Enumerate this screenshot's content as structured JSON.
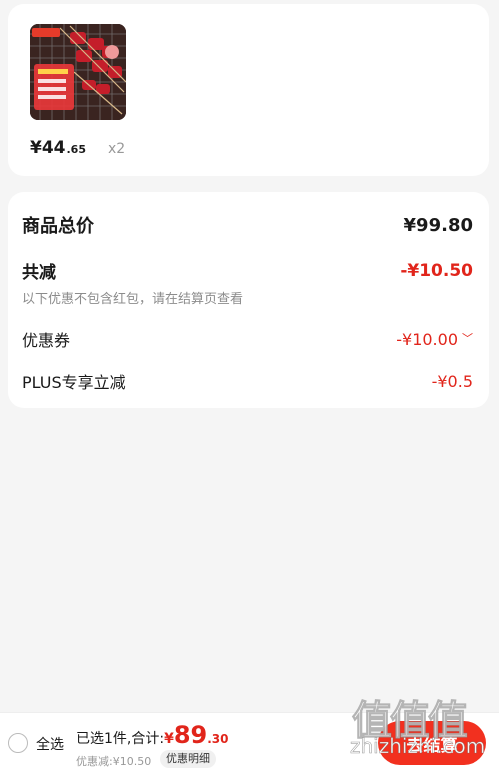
{
  "product": {
    "image_icon": "grilled-meat-skewers-image",
    "price_integer": "¥44",
    "price_decimal": ".65",
    "quantity": "x2"
  },
  "summary": {
    "total_label": "商品总价",
    "total_value": "¥99.80",
    "reduce_label": "共减",
    "reduce_value": "-¥10.50",
    "note": "以下优惠不包含红包，请在结算页查看",
    "coupon_label": "优惠券",
    "coupon_value": "-¥10.00",
    "plus_label": "PLUS专享立减",
    "plus_value": "-¥0.5"
  },
  "bottom": {
    "select_all": "全选",
    "summary_text": "已选1件,合计:",
    "currency": "¥",
    "amount_integer": "89",
    "amount_decimal": ".30",
    "discount": "优惠减:¥10.50",
    "detail_button": "优惠明细",
    "checkout_button": "去结算"
  },
  "watermark": {
    "top": "值值值",
    "bottom": "zhizhizhi.com"
  },
  "colors": {
    "accent_red": "#e1251b",
    "checkout_red": "#f2301f",
    "background": "#f5f5f5"
  }
}
